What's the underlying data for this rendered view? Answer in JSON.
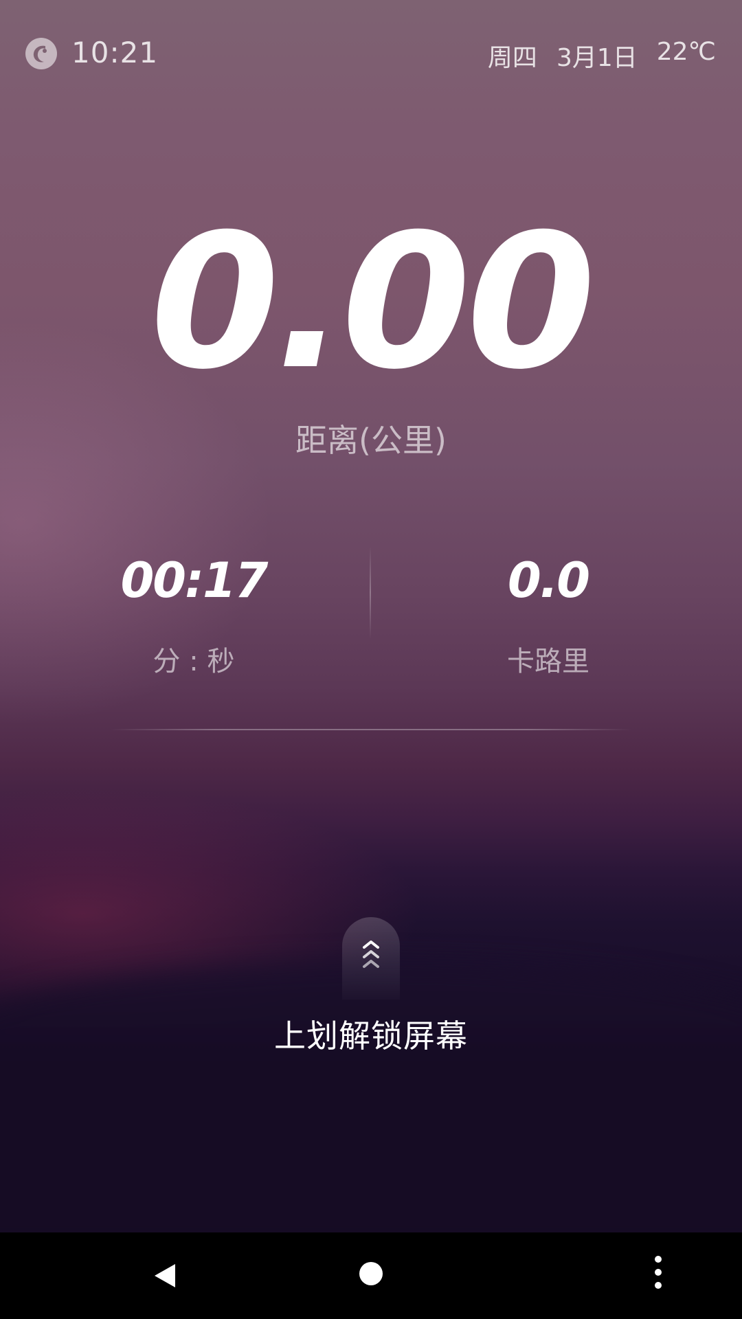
{
  "status_bar": {
    "time": "10:21",
    "weekday": "周四",
    "date": "3月1日",
    "temperature": "22℃",
    "logo_icon": "app-logo-icon"
  },
  "workout": {
    "distance": {
      "value": "0.00",
      "label": "距离(公里)"
    },
    "duration": {
      "value": "00:17",
      "label": "分 : 秒"
    },
    "calories": {
      "value": "0.0",
      "label": "卡路里"
    }
  },
  "unlock": {
    "label": "上划解锁屏幕",
    "icon": "chevrons-up-icon"
  },
  "nav_bar": {
    "icons": [
      "back-icon",
      "home-icon",
      "overflow-menu-icon"
    ]
  },
  "colors": {
    "background_top": "#7e6272",
    "background_mid": "#5c3856",
    "background_bottom": "#150b24",
    "text_primary": "#ffffff",
    "nav_bar": "#000000"
  }
}
